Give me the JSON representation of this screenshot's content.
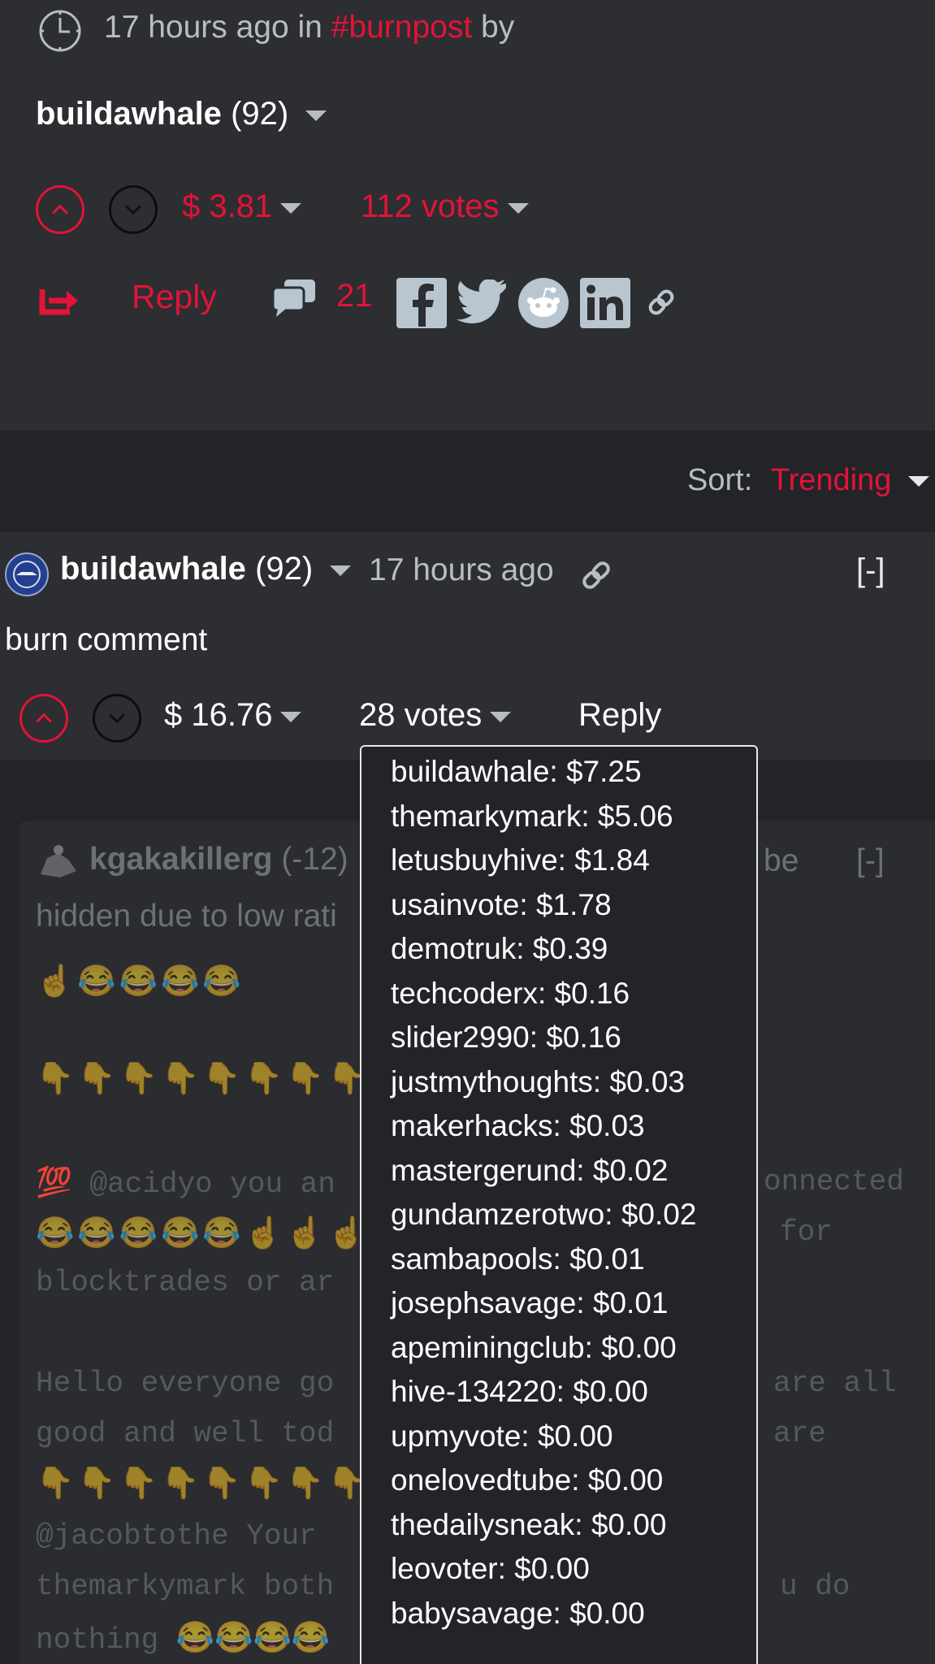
{
  "post": {
    "time_text": "17 hours ago in",
    "tag": "#burnpost",
    "by": "by",
    "author": "buildawhale",
    "reputation": "(92)",
    "payout": "$ 3.81",
    "votes": "112 votes",
    "reply_label": "Reply",
    "comment_count": "21"
  },
  "sort": {
    "label": "Sort:",
    "value": "Trending"
  },
  "comment": {
    "author": "buildawhale",
    "reputation": "(92)",
    "time": "17 hours ago",
    "collapse": "[-]",
    "body": "burn comment",
    "payout": "$ 16.76",
    "votes": "28 votes",
    "reply_label": "Reply"
  },
  "hidden_reply": {
    "author": "kgakakillerg",
    "reputation": "(-12)",
    "notice_start": "hidden due to low rati",
    "notice_end": "be",
    "collapse": "[-]",
    "line1_start": "💯 @acidyo you an",
    "line1_end": "onnected",
    "line2_end": "for",
    "line3_start": "blocktrades or ar",
    "line4_start": "Hello everyone go",
    "line4_end": "are all",
    "line5_start": "good and well tod",
    "line5_end": "are",
    "line6_start": "@jacobtothe Your",
    "line7_start": "themarkymark both",
    "line7_end": "u do",
    "line8_start": "nothing"
  },
  "voters": [
    "buildawhale: $7.25",
    "themarkymark: $5.06",
    "letusbuyhive: $1.84",
    "usainvote: $1.78",
    "demotruk: $0.39",
    "techcoderx: $0.16",
    "slider2990: $0.16",
    "justmythoughts: $0.03",
    "makerhacks: $0.03",
    "mastergerund: $0.02",
    "gundamzerotwo: $0.02",
    "sambapools: $0.01",
    "josephsavage: $0.01",
    "apeminingclub: $0.00",
    "hive-134220: $0.00",
    "upmyvote: $0.00",
    "onelovedtube: $0.00",
    "thedailysneak: $0.00",
    "leovoter: $0.00",
    "babysavage: $0.00"
  ],
  "colors": {
    "accent": "#e31337",
    "background": "#2c2e31",
    "dark_band": "#222428"
  }
}
